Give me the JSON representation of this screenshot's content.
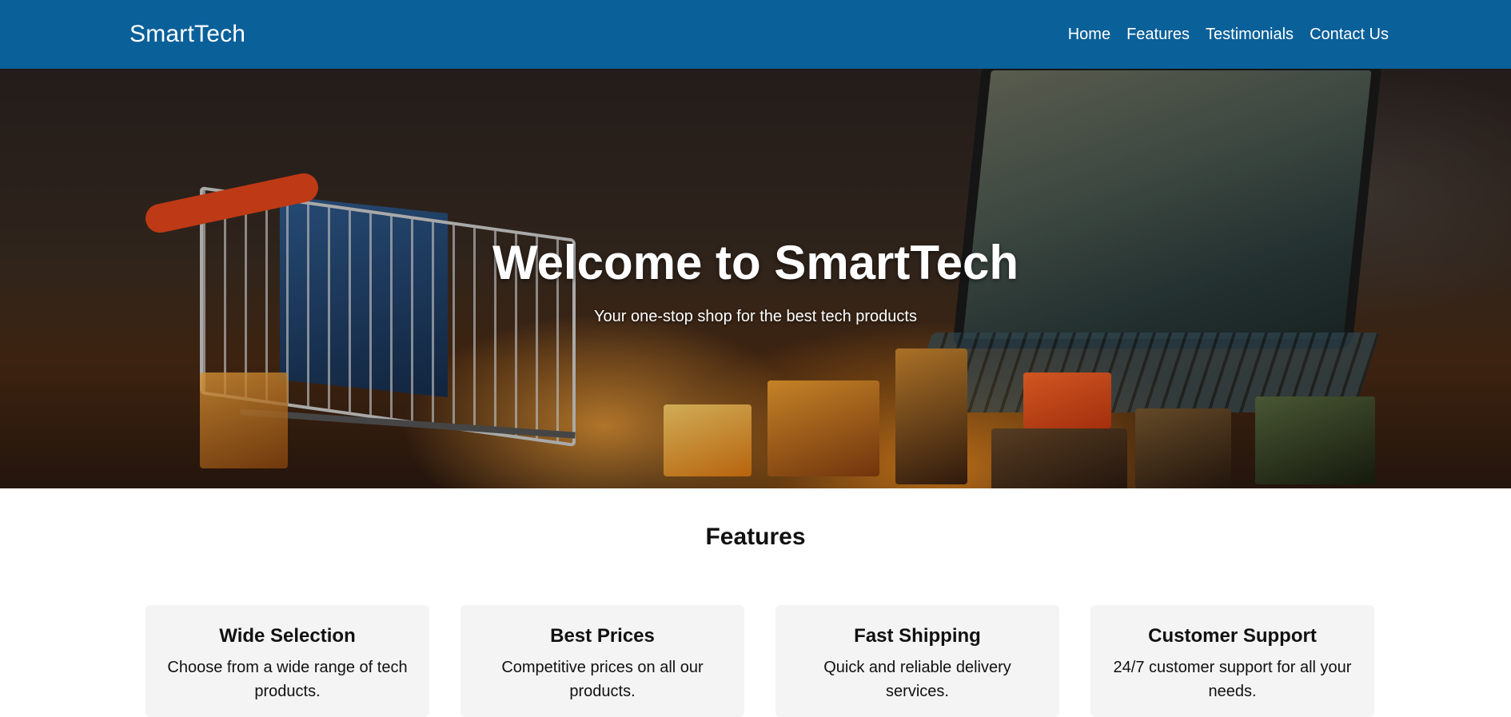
{
  "header": {
    "brand": "SmartTech",
    "background_color": "#0a6099",
    "nav": [
      {
        "label": "Home"
      },
      {
        "label": "Features"
      },
      {
        "label": "Testimonials"
      },
      {
        "label": "Contact Us"
      }
    ]
  },
  "hero": {
    "title": "Welcome to SmartTech",
    "subtitle": "Your one-stop shop for the best tech products"
  },
  "features": {
    "title": "Features",
    "cards": [
      {
        "title": "Wide Selection",
        "text": "Choose from a wide range of tech products."
      },
      {
        "title": "Best Prices",
        "text": "Competitive prices on all our products."
      },
      {
        "title": "Fast Shipping",
        "text": "Quick and reliable delivery services."
      },
      {
        "title": "Customer Support",
        "text": "24/7 customer support for all your needs."
      }
    ]
  }
}
